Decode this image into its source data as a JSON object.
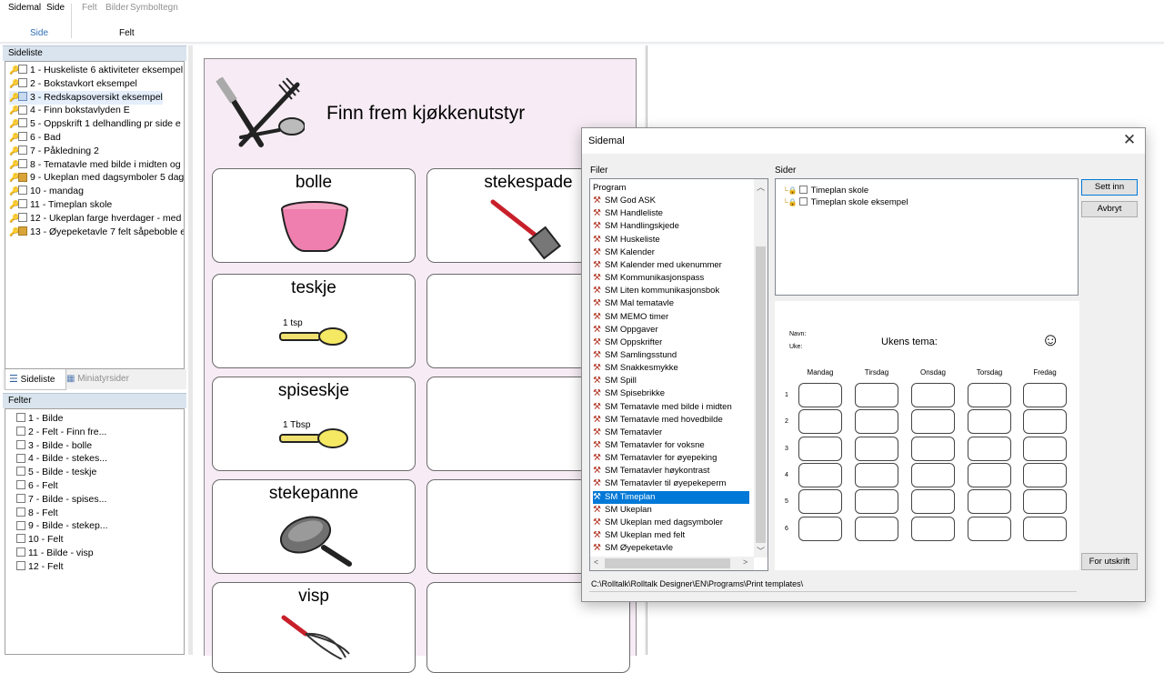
{
  "ribbon": {
    "tabs": [
      "Sidemal",
      "Side",
      "Felt",
      "Bilder",
      "Symboltegn"
    ],
    "group_side": "Side",
    "group_felt": "Felt"
  },
  "sideliste": {
    "header": "Sideliste",
    "items": [
      {
        "label": "1 - Huskeliste 6 aktiviteter eksempel",
        "state": "plain"
      },
      {
        "label": "2 - Bokstavkort eksempel",
        "state": "plain"
      },
      {
        "label": "3 - Redskapsoversikt eksempel",
        "state": "selected"
      },
      {
        "label": "4 - Finn bokstavlyden E",
        "state": "plain"
      },
      {
        "label": "5 - Oppskrift 1 delhandling pr side e",
        "state": "plain"
      },
      {
        "label": "6 - Bad",
        "state": "plain"
      },
      {
        "label": "7 - Påkledning 2",
        "state": "plain"
      },
      {
        "label": "8 - Tematavle med bilde i midten og",
        "state": "plain"
      },
      {
        "label": "9 - Ukeplan med dagsymboler 5 dag",
        "state": "orange"
      },
      {
        "label": "10 - mandag",
        "state": "plain"
      },
      {
        "label": "11 - Timeplan skole",
        "state": "plain"
      },
      {
        "label": "12 - Ukeplan farge hverdager - med",
        "state": "plain"
      },
      {
        "label": "13 - Øyepeketavle 7 felt såpeboble e",
        "state": "orange"
      }
    ],
    "tab_active": "Sideliste",
    "tab_inactive": "Miniatyrsider"
  },
  "felter": {
    "header": "Felter",
    "items": [
      "1 - Bilde",
      "2 - Felt - Finn fre...",
      "3 - Bilde - bolle",
      "4 - Bilde - stekes...",
      "5 - Bilde - teskje",
      "6 - Felt",
      "7 - Bilde - spises...",
      "8 - Felt",
      "9 - Bilde - stekep...",
      "10 - Felt",
      "11 - Bilde - visp",
      "12 - Felt"
    ]
  },
  "page": {
    "title": "Finn frem kjøkkenutstyr",
    "cards": [
      "bolle",
      "stekespade",
      "teskje",
      "spiseskje",
      "stekepanne",
      "visp"
    ],
    "tsp_label": "1 tsp",
    "tbsp_label": "1 Tbsp"
  },
  "dialog": {
    "title": "Sidemal",
    "close": "✕",
    "files_label": "Filer",
    "pages_label": "Sider",
    "files": [
      "Program",
      "SM God ASK",
      "SM Handleliste",
      "SM Handlingskjede",
      "SM Huskeliste",
      "SM Kalender",
      "SM Kalender med ukenummer",
      "SM Kommunikasjonspass",
      "SM Liten kommunikasjonsbok",
      "SM Mal tematavle",
      "SM MEMO timer",
      "SM Oppgaver",
      "SM Oppskrifter",
      "SM Samlingsstund",
      "SM Snakkesmykke",
      "SM Spill",
      "SM Spisebrikke",
      "SM Tematavle med bilde i midten",
      "SM Tematavle med hovedbilde",
      "SM Tematavler",
      "SM Tematavler for voksne",
      "SM Tematavler for øyepeking",
      "SM Tematavler høykontrast",
      "SM Tematavler til øyepekeperm",
      "SM Timeplan",
      "SM Ukeplan",
      "SM Ukeplan med dagsymboler",
      "SM Ukeplan med felt",
      "SM Øyepeketavle"
    ],
    "selected_file": "SM Timeplan",
    "pages": [
      "Timeplan skole",
      "Timeplan skole eksempel"
    ],
    "btn_insert": "Sett inn",
    "btn_cancel": "Avbryt",
    "btn_print": "For utskrift",
    "path": "C:\\Rolltalk\\Rolltalk Designer\\EN\\Programs\\Print templates\\",
    "preview": {
      "navn": "Navn:",
      "uke": "Uke:",
      "heading": "Ukens tema:",
      "smiley": "☺",
      "days": [
        "Mandag",
        "Tirsdag",
        "Onsdag",
        "Torsdag",
        "Fredag"
      ],
      "rows": [
        "1",
        "2",
        "3",
        "4",
        "5",
        "6"
      ]
    }
  }
}
